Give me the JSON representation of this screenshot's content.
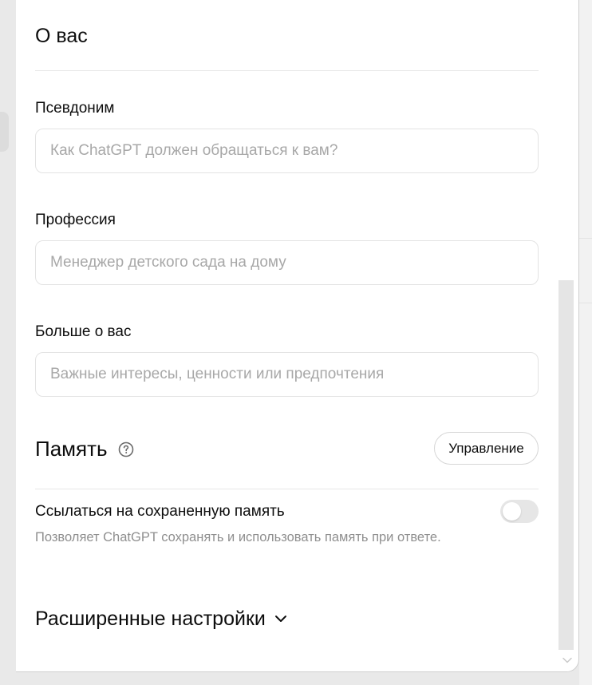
{
  "about": {
    "title": "О вас"
  },
  "fields": {
    "nickname": {
      "label": "Псевдоним",
      "placeholder": "Как ChatGPT должен обращаться к вам?",
      "value": ""
    },
    "profession": {
      "label": "Профессия",
      "placeholder": "Менеджер детского сада на дому",
      "value": ""
    },
    "more_about": {
      "label": "Больше о вас",
      "placeholder": "Важные интересы, ценности или предпочтения",
      "value": ""
    }
  },
  "memory": {
    "title": "Память",
    "help_icon": "question-circle-icon",
    "manage_label": "Управление",
    "reference_saved": {
      "label": "Ссылаться на сохраненную память",
      "description": "Позволяет ChatGPT сохранять и использовать память при ответе.",
      "enabled": false
    }
  },
  "advanced": {
    "label": "Расширенные настройки",
    "icon": "chevron-down-icon"
  },
  "scrollbar": {
    "position_fraction": 0.41,
    "down_icon": "chevron-down-icon"
  },
  "colors": {
    "text": "#0d0d0d",
    "placeholder": "#a8a8a8",
    "muted": "#8f8f8f",
    "border": "#e3e3e3",
    "toggle_off": "#e6e6e6"
  }
}
